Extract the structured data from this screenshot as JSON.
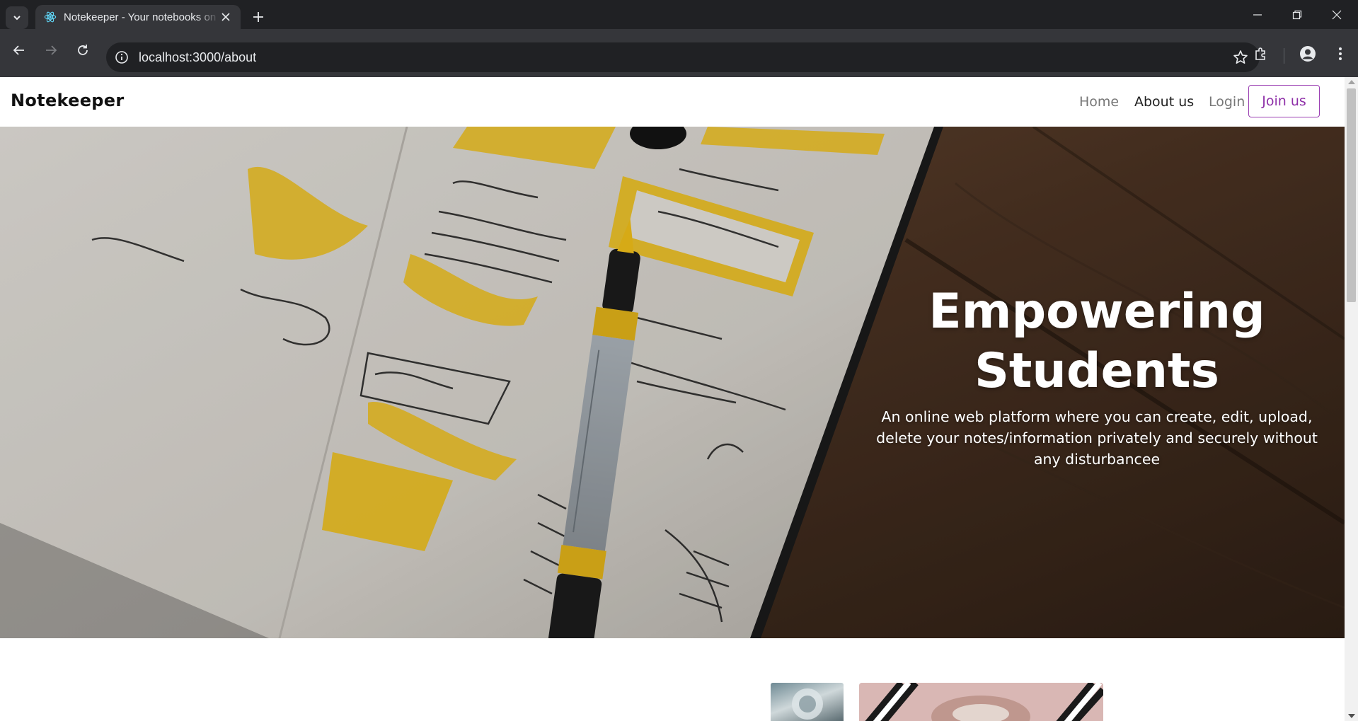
{
  "browser": {
    "tab_title": "Notekeeper - Your notebooks on cloud",
    "url": "localhost:3000/about"
  },
  "navbar": {
    "brand": "Notekeeper",
    "links": [
      {
        "label": "Home"
      },
      {
        "label": "About us"
      },
      {
        "label": "Login"
      }
    ],
    "join_label": "Join us",
    "accent_color": "#8e2fa8"
  },
  "hero": {
    "title_line1": "Empowering",
    "title_line2": "Students",
    "subtitle": "An online web platform where you can create, edit, upload, delete your notes/information privately and securely without any disturbancee"
  }
}
